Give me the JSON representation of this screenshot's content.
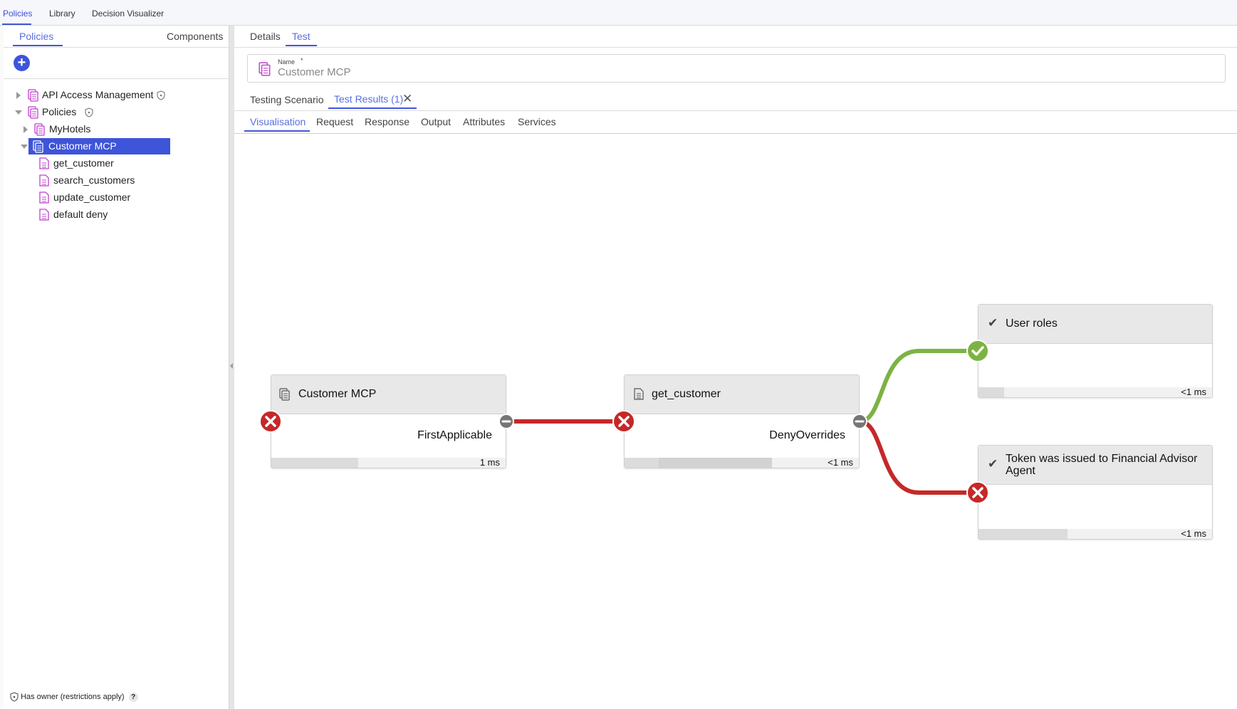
{
  "topnav": {
    "items": [
      {
        "label": "Policies",
        "active": true
      },
      {
        "label": "Library",
        "active": false
      },
      {
        "label": "Decision Visualizer",
        "active": false
      }
    ]
  },
  "sidebar": {
    "tabs": [
      {
        "label": "Policies",
        "active": true
      },
      {
        "label": "Components",
        "active": false
      }
    ],
    "tree": [
      {
        "label": "API Access Management",
        "type": "policy-set",
        "shield": true,
        "expanded": false
      },
      {
        "label": "Policies",
        "type": "policy-set",
        "shield": true,
        "expanded": true
      },
      {
        "label": "MyHotels",
        "type": "policy-set",
        "expanded": false
      },
      {
        "label": "Customer MCP",
        "type": "policy-set",
        "expanded": true,
        "selected": true
      },
      {
        "label": "get_customer",
        "type": "policy"
      },
      {
        "label": "search_customers",
        "type": "policy"
      },
      {
        "label": "update_customer",
        "type": "policy"
      },
      {
        "label": "default deny",
        "type": "policy"
      }
    ],
    "footer": {
      "text": "Has owner (restrictions apply)",
      "help": "?"
    }
  },
  "main": {
    "tabs": [
      {
        "label": "Details",
        "active": false
      },
      {
        "label": "Test",
        "active": true
      }
    ],
    "name_field": {
      "label": "Name",
      "required_mark": "*",
      "value": "Customer MCP"
    },
    "test_tabs": [
      {
        "label": "Testing Scenario",
        "active": false
      },
      {
        "label": "Test Results (1)",
        "active": true,
        "closable": true
      }
    ],
    "result_tabs": [
      {
        "label": "Visualisation",
        "active": true
      },
      {
        "label": "Request",
        "active": false
      },
      {
        "label": "Response",
        "active": false
      },
      {
        "label": "Output",
        "active": false
      },
      {
        "label": "Attributes",
        "active": false
      },
      {
        "label": "Services",
        "active": false
      }
    ]
  },
  "visualisation": {
    "colors": {
      "deny": "#c62828",
      "permit": "#7cb342",
      "not_applicable": "#757575"
    },
    "nodes": [
      {
        "id": "customer-mcp",
        "title": "Customer MCP",
        "icon": "policy-set-icon",
        "algorithm": "FirstApplicable",
        "time": "1 ms",
        "input_status": "deny",
        "output_status": "not-applicable",
        "progress": 0.37
      },
      {
        "id": "get-customer",
        "title": "get_customer",
        "icon": "policy-icon",
        "algorithm": "DenyOverrides",
        "time": "<1 ms",
        "input_status": "deny",
        "output_status": "not-applicable",
        "progress": 0.63
      },
      {
        "id": "user-roles",
        "title": "User roles",
        "icon": "check-icon",
        "time": "<1 ms",
        "input_status": "permit",
        "progress": 0.11
      },
      {
        "id": "token-issued",
        "title": "Token was issued to Financial Advisor Agent",
        "icon": "check-icon",
        "time": "<1 ms",
        "input_status": "deny",
        "progress": 0.38
      }
    ]
  }
}
